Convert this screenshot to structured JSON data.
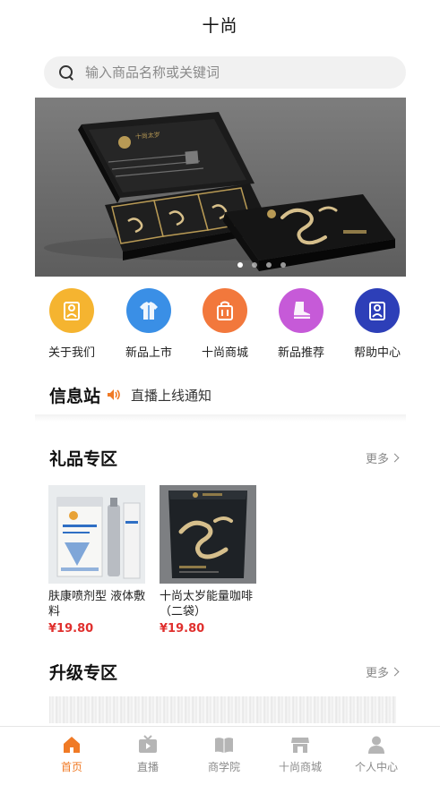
{
  "header": {
    "title": "十尚"
  },
  "search": {
    "placeholder": "输入商品名称或关键词"
  },
  "banner": {
    "box_text": "十尚太岁",
    "slide_count": 4,
    "active_slide": 1
  },
  "quick_links": [
    {
      "label": "关于我们",
      "icon": "person-icon",
      "color": "#f5b430"
    },
    {
      "label": "新品上市",
      "icon": "shirt-icon",
      "color": "#3a8fe6"
    },
    {
      "label": "十尚商城",
      "icon": "bag-icon",
      "color": "#f2783c"
    },
    {
      "label": "新品推荐",
      "icon": "boot-icon",
      "color": "#c65ad8"
    },
    {
      "label": "帮助中心",
      "icon": "user-card-icon",
      "color": "#2d3fb8"
    }
  ],
  "info": {
    "title": "信息站",
    "message": "直播上线通知"
  },
  "gift_section": {
    "title": "礼品专区",
    "more": "更多",
    "products": [
      {
        "name": "肤康喷剂型 液体敷料",
        "price": "¥19.80"
      },
      {
        "name": "十尚太岁能量咖啡（二袋）",
        "price": "¥19.80"
      }
    ]
  },
  "upgrade_section": {
    "title": "升级专区",
    "more": "更多"
  },
  "tabbar": {
    "items": [
      {
        "label": "首页",
        "icon": "home-icon",
        "active": true
      },
      {
        "label": "直播",
        "icon": "tv-icon",
        "active": false
      },
      {
        "label": "商学院",
        "icon": "book-icon",
        "active": false
      },
      {
        "label": "十尚商城",
        "icon": "store-icon",
        "active": false
      },
      {
        "label": "个人中心",
        "icon": "profile-icon",
        "active": false
      }
    ],
    "active_color": "#f07a25",
    "inactive_color": "#b5b5b5"
  }
}
